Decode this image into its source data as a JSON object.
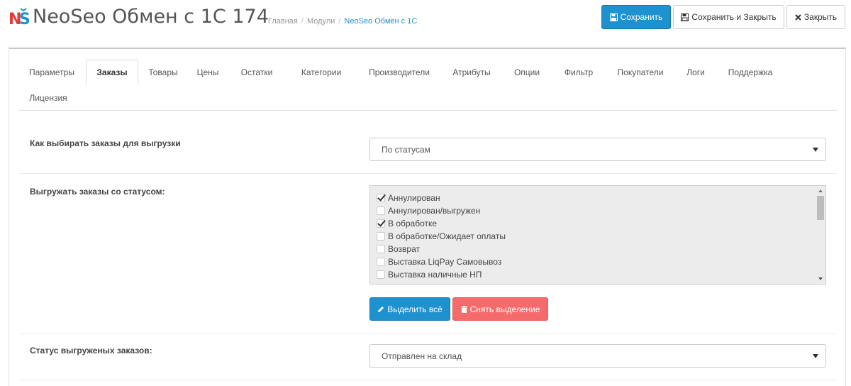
{
  "header": {
    "title": "NeoSeo Обмен с 1С 174",
    "breadcrumbs": [
      "Главная",
      "Модули",
      "NeoSeo Обмен с 1С"
    ],
    "logo_icon": "neoseo-logo-icon",
    "buttons": {
      "save": "Сохранить",
      "save_close": "Сохранить и Закрыть",
      "close": "Закрыть"
    }
  },
  "tabs": [
    {
      "label": "Параметры",
      "active": false
    },
    {
      "label": "Заказы",
      "active": true
    },
    {
      "label": "Товары",
      "active": false
    },
    {
      "label": "Цены",
      "active": false
    },
    {
      "label": "Остатки",
      "active": false
    },
    {
      "label": "Категории",
      "active": false
    },
    {
      "label": "Производители",
      "active": false
    },
    {
      "label": "Атрибуты",
      "active": false
    },
    {
      "label": "Опции",
      "active": false
    },
    {
      "label": "Фильтр",
      "active": false
    },
    {
      "label": "Покупатели",
      "active": false
    },
    {
      "label": "Логи",
      "active": false
    },
    {
      "label": "Поддержка",
      "active": false
    },
    {
      "label": "Лицензия",
      "active": false
    }
  ],
  "form": {
    "order_selection": {
      "label": "Как выбирать заказы для выгрузки",
      "value": "По статусам"
    },
    "export_statuses": {
      "label": "Выгружать заказы со статусом:",
      "items": [
        {
          "label": "Аннулирован",
          "checked": true
        },
        {
          "label": "Аннулирован/выгружен",
          "checked": false
        },
        {
          "label": "В обработке",
          "checked": true
        },
        {
          "label": "В обработке/Ожидает оплаты",
          "checked": false
        },
        {
          "label": "Возврат",
          "checked": false
        },
        {
          "label": "Выставка LiqPay Самовывоз",
          "checked": false
        },
        {
          "label": "Выставка наличные НП",
          "checked": false
        }
      ],
      "select_all": "Выделить всё",
      "deselect": "Снять выделение"
    },
    "exported_status": {
      "label": "Статус выгруженых заказов:",
      "value": "Отправлен на склад"
    }
  },
  "colors": {
    "primary": "#1e91cf",
    "danger": "#f56b6b",
    "logo_red": "#e53935",
    "logo_blue": "#1e91cf"
  }
}
